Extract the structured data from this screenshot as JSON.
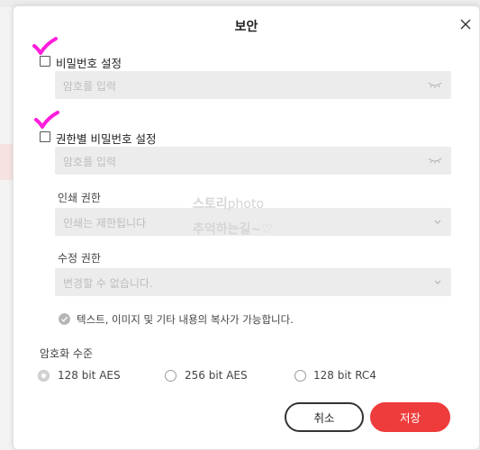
{
  "dialog": {
    "title": "보안",
    "close_symbol": "×"
  },
  "password": {
    "checkbox_label": "비밀번호 설정",
    "placeholder": "암호를 입력"
  },
  "permission_password": {
    "checkbox_label": "권한별 비밀번호 설정",
    "placeholder": "암호를 입력",
    "print": {
      "label": "인쇄 권한",
      "value": "인쇄는 제한됩니다"
    },
    "edit": {
      "label": "수정 권한",
      "value": "변경할 수 없습니다."
    },
    "copy_notice": "텍스트, 이미지 및 기타 내용의 복사가 가능합니다."
  },
  "encryption": {
    "label": "암호화 수준",
    "options": [
      {
        "label": "128 bit AES",
        "selected": true
      },
      {
        "label": "256 bit AES",
        "selected": false
      },
      {
        "label": "128 bit RC4",
        "selected": false
      }
    ]
  },
  "buttons": {
    "cancel": "취소",
    "save": "저장"
  },
  "watermark": {
    "line1_bold": "스토리",
    "line1_rest": "photo",
    "line2": "추억하는길~♡"
  },
  "colors": {
    "accent_red": "#ee3b3b",
    "annotation_magenta": "#ff1ddc",
    "field_bg": "#ececec"
  },
  "icons": {
    "close": "close-icon",
    "password_reveal": "eye-closed-icon",
    "dropdown": "chevron-down-icon",
    "info": "check-circle-icon"
  }
}
